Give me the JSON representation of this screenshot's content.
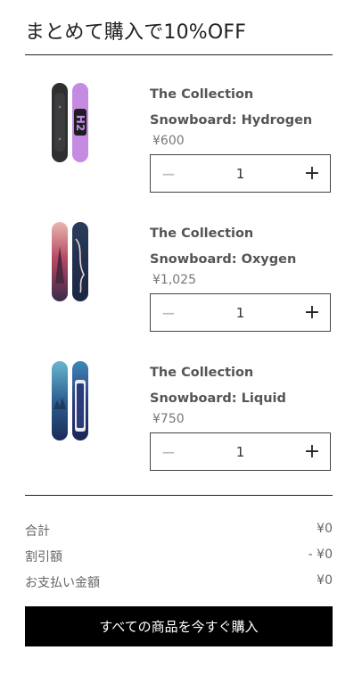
{
  "header": {
    "title": "まとめて購入で10%OFF"
  },
  "products": [
    {
      "name": "The Collection Snowboard: Hydrogen",
      "price": "¥600",
      "quantity": "1",
      "decrease_icon": "minus-icon",
      "increase_icon": "plus-icon"
    },
    {
      "name": "The Collection Snowboard: Oxygen",
      "price": "¥1,025",
      "quantity": "1",
      "decrease_icon": "minus-icon",
      "increase_icon": "plus-icon"
    },
    {
      "name": "The Collection Snowboard: Liquid",
      "price": "¥750",
      "quantity": "1",
      "decrease_icon": "minus-icon",
      "increase_icon": "plus-icon"
    }
  ],
  "summary": {
    "subtotal_label": "合計",
    "subtotal_value": "¥0",
    "discount_label": "割引額",
    "discount_value": "- ¥0",
    "total_label": "お支払い金額",
    "total_value": "¥0"
  },
  "buy_button": {
    "label": "すべての商品を今すぐ購入"
  },
  "colors": {
    "button_bg": "#000000",
    "button_text": "#ffffff",
    "rule": "#222222"
  }
}
